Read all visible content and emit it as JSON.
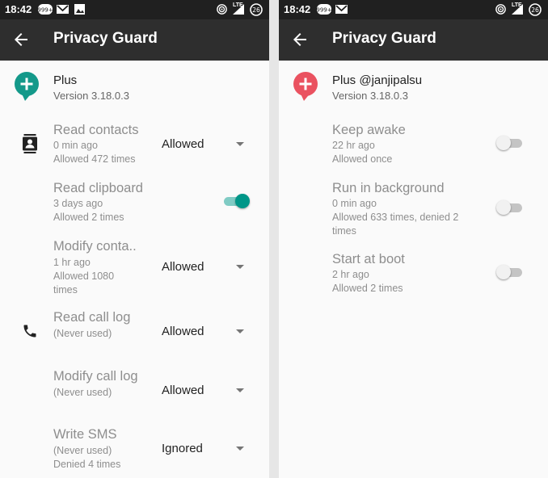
{
  "status": {
    "time": "18:42",
    "battery": "26",
    "network": "LTE",
    "notif_badge": "999+"
  },
  "colors": {
    "accent": "#009688",
    "left_app_icon": "#14998a",
    "right_app_icon": "#ea5260",
    "appbar": "#2e2e2e",
    "statusbar": "#202020"
  },
  "left": {
    "title": "Privacy Guard",
    "app": {
      "name": "Plus",
      "version": "Version 3.18.0.3"
    },
    "items": [
      {
        "title": "Read contacts",
        "time": "0 min ago",
        "count": "Allowed 472 times",
        "control": "dropdown",
        "value": "Allowed",
        "icon": "contacts-icon"
      },
      {
        "title": "Read clipboard",
        "time": "3 days ago",
        "count": "Allowed 2 times",
        "control": "switch",
        "checked": true
      },
      {
        "title": "Modify conta..",
        "time": "1 hr ago",
        "count": "Allowed 1080 times",
        "control": "dropdown",
        "value": "Allowed"
      },
      {
        "title": "Read call log",
        "time": "(Never used)",
        "count": "",
        "control": "dropdown",
        "value": "Allowed",
        "icon": "phone-icon"
      },
      {
        "title": "Modify call log",
        "time": "(Never used)",
        "count": "",
        "control": "dropdown",
        "value": "Allowed"
      },
      {
        "title": "Write SMS",
        "time": "(Never used)",
        "count": "Denied 4 times",
        "control": "dropdown",
        "value": "Ignored"
      }
    ]
  },
  "right": {
    "title": "Privacy Guard",
    "app": {
      "name": "Plus @janjipalsu",
      "version": "Version 3.18.0.3"
    },
    "items": [
      {
        "title": "Keep awake",
        "time": "22 hr ago",
        "count": "Allowed once",
        "control": "switch",
        "checked": false
      },
      {
        "title": "Run in background",
        "time": "0 min ago",
        "count": "Allowed 633 times, denied 2 times",
        "control": "switch",
        "checked": false
      },
      {
        "title": "Start at boot",
        "time": "2 hr ago",
        "count": "Allowed 2 times",
        "control": "switch",
        "checked": false
      }
    ]
  }
}
